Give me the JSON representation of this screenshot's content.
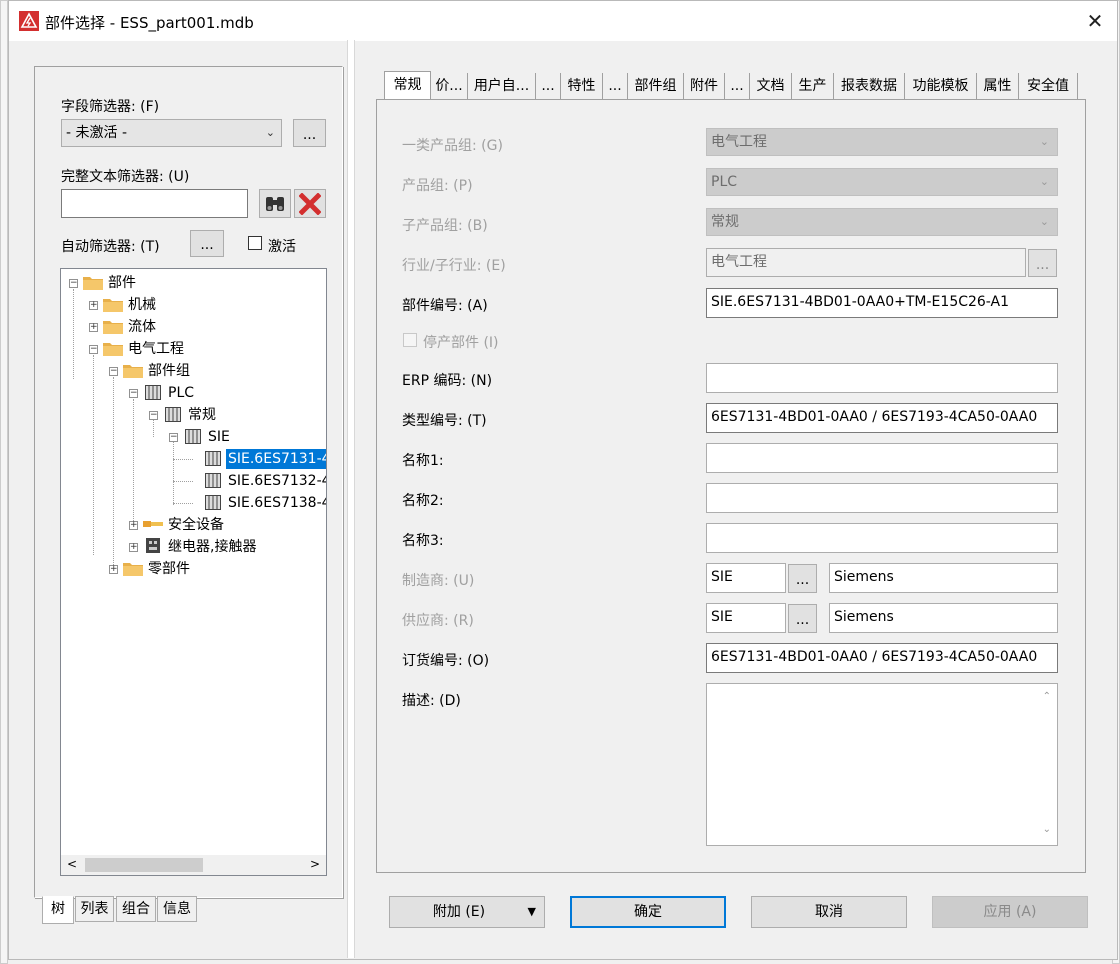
{
  "window": {
    "title": "部件选择 - ESS_part001.mdb",
    "close": "✕"
  },
  "left": {
    "field_filter_label": "字段筛选器: (F)",
    "field_filter_value": "- 未激活 -",
    "more": "...",
    "fulltext_label": "完整文本筛选器: (U)",
    "fulltext_value": "",
    "auto_filter_label": "自动筛选器: (T)",
    "activate_label": "激活",
    "tree": [
      {
        "label": "部件"
      },
      {
        "label": "机械"
      },
      {
        "label": "流体"
      },
      {
        "label": "电气工程"
      },
      {
        "label": "部件组"
      },
      {
        "label": "PLC"
      },
      {
        "label": "常规"
      },
      {
        "label": "SIE"
      },
      {
        "label": "SIE.6ES7131-4"
      },
      {
        "label": "SIE.6ES7132-4"
      },
      {
        "label": "SIE.6ES7138-4"
      },
      {
        "label": "安全设备"
      },
      {
        "label": "继电器,接触器"
      },
      {
        "label": "零部件"
      }
    ],
    "tabs": [
      "树",
      "列表",
      "组合",
      "信息"
    ]
  },
  "right": {
    "tabs": [
      "常规",
      "价...",
      "用户自...",
      "...",
      "特性",
      "...",
      "部件组",
      "附件",
      "...",
      "文档",
      "生产",
      "报表数据",
      "功能模板",
      "属性",
      "安全值"
    ],
    "fields": {
      "product_group_1_label": "一类产品组: (G)",
      "product_group_1": "电气工程",
      "product_group_label": "产品组: (P)",
      "product_group": "PLC",
      "sub_product_group_label": "子产品组: (B)",
      "sub_product_group": "常规",
      "industry_label": "行业/子行业: (E)",
      "industry": "电气工程",
      "part_number_label": "部件编号: (A)",
      "part_number": "SIE.6ES7131-4BD01-0AA0+TM-E15C26-A1",
      "discontinued_label": "停产部件 (I)",
      "erp_label": "ERP 编码: (N)",
      "erp": "",
      "type_number_label": "类型编号: (T)",
      "type_number": "6ES7131-4BD01-0AA0 / 6ES7193-4CA50-0AA0",
      "name1_label": "名称1:",
      "name2_label": "名称2:",
      "name3_label": "名称3:",
      "manufacturer_label": "制造商: (U)",
      "manufacturer_code": "SIE",
      "manufacturer_name": "Siemens",
      "supplier_label": "供应商: (R)",
      "supplier_code": "SIE",
      "supplier_name": "Siemens",
      "order_number_label": "订货编号: (O)",
      "order_number": "6ES7131-4BD01-0AA0 / 6ES7193-4CA50-0AA0",
      "description_label": "描述: (D)"
    },
    "buttons": {
      "extra": "附加 (E)",
      "ok": "确定",
      "cancel": "取消",
      "apply": "应用 (A)"
    }
  }
}
